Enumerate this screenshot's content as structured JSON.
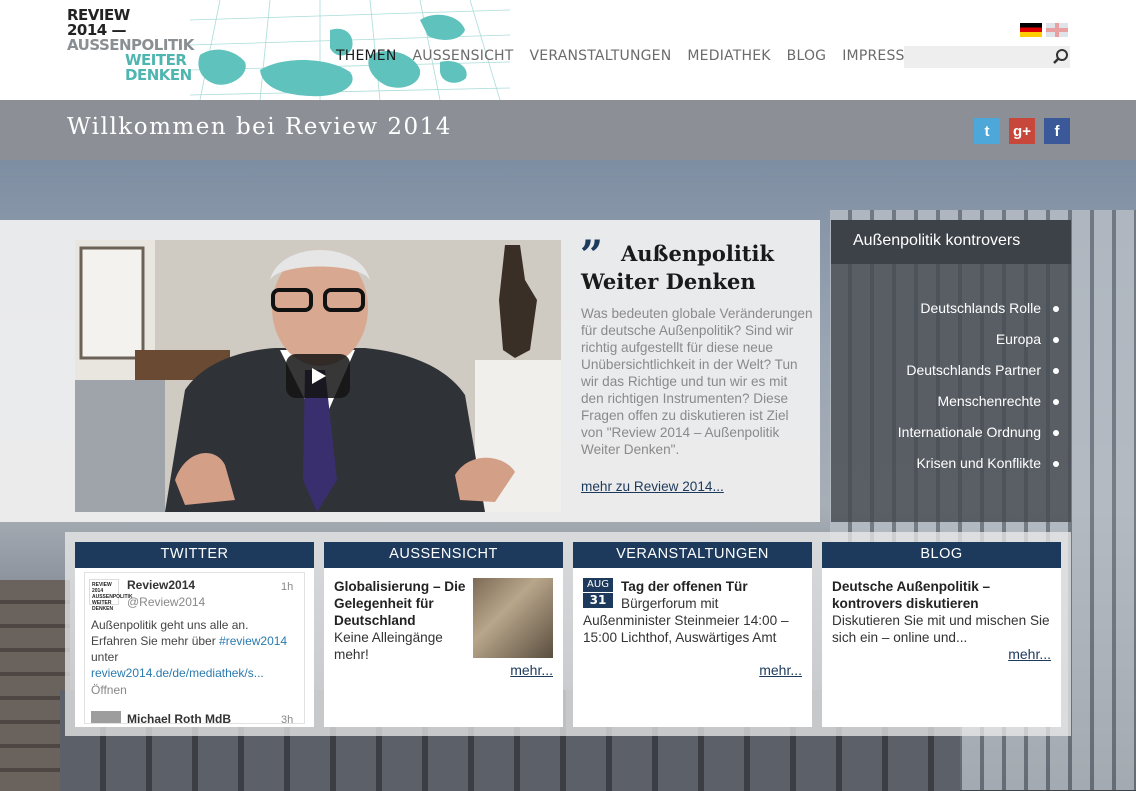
{
  "logo": {
    "line1": "REVIEW",
    "line2": "2014 —",
    "line3": "AUSSENPOLITIK",
    "line4": "WEITER",
    "line5": "DENKEN"
  },
  "nav": {
    "items": [
      "THEMEN",
      "AUSSENSICHT",
      "VERANSTALTUNGEN",
      "MEDIATHEK",
      "BLOG",
      "IMPRESSUM"
    ],
    "active": "THEMEN"
  },
  "search": {
    "placeholder": ""
  },
  "welcome": {
    "title": "Willkommen bei Review 2014"
  },
  "social": {
    "twitter": "t",
    "googleplus": "g+",
    "facebook": "f"
  },
  "feature": {
    "quote_mark": "”",
    "title": "Außenpolitik Weiter Denken",
    "text": "Was bedeuten globale Veränderungen für deutsche Außenpolitik? Sind wir richtig aufgestellt für diese neue Unübersichtlichkeit in der Welt? Tun wir das Richtige und tun wir es mit den richtigen Instrumenten? Diese Fragen offen zu diskutieren ist Ziel von \"Review 2014 – Außenpolitik Weiter Denken\".",
    "link": "mehr zu Review 2014..."
  },
  "side_panel": {
    "header": "Außenpolitik kontrovers",
    "items": [
      "Deutschlands Rolle",
      "Europa",
      "Deutschlands Partner",
      "Menschenrechte",
      "Internationale Ordnung",
      "Krisen und Konflikte"
    ]
  },
  "boxes": {
    "twitter": {
      "header": "TWITTER",
      "avatar_text": "REVIEW 2014 AUSSENPOLITIK WEITER DENKEN",
      "name": "Review2014",
      "handle": "@Review2014",
      "time": "1h",
      "text_1": "Außenpolitik geht uns alle an. Erfahren Sie mehr über ",
      "hashtag": "#review2014",
      "text_2": " unter ",
      "url": "review2014.de/de/mediathek/s...",
      "open": "Öffnen",
      "next_name": "Michael Roth MdB",
      "next_time": "3h"
    },
    "aussensicht": {
      "header": "AUSSENSICHT",
      "title": "Globalisierung – Die Gelegenheit für Deutschland",
      "text": "Keine Alleingänge mehr!",
      "more": "mehr..."
    },
    "veranstaltungen": {
      "header": "VERANSTALTUNGEN",
      "month": "AUG",
      "day": "31",
      "title": "Tag der offenen Tür",
      "text": "Bürgerforum mit Außenminister Steinmeier 14:00 – 15:00 Lichthof, Auswärtiges Amt",
      "more": "mehr..."
    },
    "blog": {
      "header": "BLOG",
      "title": "Deutsche Außenpolitik – kontrovers diskutieren",
      "text": "Diskutieren Sie mit und mischen Sie sich ein – online und...",
      "more": "mehr..."
    }
  },
  "colors": {
    "brand_navy": "#1d3a5c",
    "brand_teal": "#4fb5b0",
    "welcome_bar": "#8c9096"
  }
}
